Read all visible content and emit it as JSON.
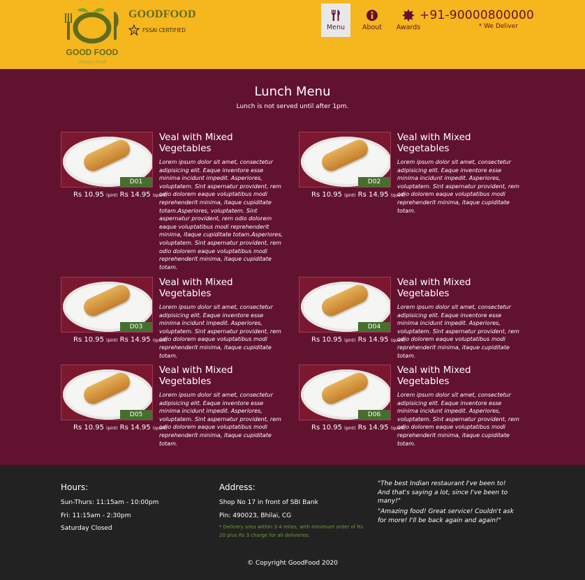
{
  "header": {
    "logo_text": "GOOD FOOD",
    "logo_tagline": "always fresh",
    "brand_name": "GOODFOOD",
    "fssai_label": "FSSAI CERTIFIED",
    "phone": "+91-90000800000",
    "deliver_text": "* We Deliver",
    "nav": [
      {
        "label": "Menu",
        "icon": "fork-knife-icon",
        "active": true
      },
      {
        "label": "About",
        "icon": "info-icon",
        "active": false
      },
      {
        "label": "Awards",
        "icon": "award-icon",
        "active": false
      }
    ],
    "colors": {
      "background": "#f6b61e",
      "accent": "#61122f"
    }
  },
  "menu": {
    "title": "Lunch Menu",
    "subtitle": "Lunch is not served until after 1pm.",
    "items": [
      {
        "code": "D01",
        "name": "Veal with Mixed Vegetables",
        "price_pint": "Rs 10.95",
        "pint_label": "(pint)",
        "price_quart": "Rs 14.95",
        "quart_label": "(quart)",
        "description": "Lorem ipsum dolor sit amet, consectetur adipisicing elit. Eaque inventore esse minima incidunt impedit. Asperiores, voluptatem. Sint aspernatur provident, rem odio dolorem eaque voluptatibus modi reprehenderit minima, itaque cupiditate totam.Asperiores, voluptatem. Sint aspernatur provident, rem odio dolorem eaque voluptatibus modi reprehenderit minima, itaque cupiditate totam.Asperiores, voluptatem. Sint aspernatur provident, rem odio dolorem eaque voluptatibus modi reprehenderit minima, itaque cupiditate totam."
      },
      {
        "code": "D02",
        "name": "Veal with Mixed Vegetables",
        "price_pint": "Rs 10.95",
        "pint_label": "(pint)",
        "price_quart": "Rs 14.95",
        "quart_label": "(quart)",
        "description": "Lorem ipsum dolor sit amet, consectetur adipisicing elit. Eaque inventore esse minima incidunt impedit. Asperiores, voluptatem. Sint aspernatur provident, rem odio dolorem eaque voluptatibus modi reprehenderit minima, itaque cupiditate totam."
      },
      {
        "code": "D03",
        "name": "Veal with Mixed Vegetables",
        "price_pint": "Rs 10.95",
        "pint_label": "(pint)",
        "price_quart": "Rs 14.95",
        "quart_label": "(quart)",
        "description": "Lorem ipsum dolor sit amet, consectetur adipisicing elit. Eaque inventore esse minima incidunt impedit. Asperiores, voluptatem. Sint aspernatur provident, rem odio dolorem eaque voluptatibus modi reprehenderit minima, itaque cupiditate totam."
      },
      {
        "code": "D04",
        "name": "Veal with Mixed Vegetables",
        "price_pint": "Rs 10.95",
        "pint_label": "(pint)",
        "price_quart": "Rs 14.95",
        "quart_label": "(quart)",
        "description": "Lorem ipsum dolor sit amet, consectetur adipisicing elit. Eaque inventore esse minima incidunt impedit. Asperiores, voluptatem. Sint aspernatur provident, rem odio dolorem eaque voluptatibus modi reprehenderit minima, itaque cupiditate totam."
      },
      {
        "code": "D05",
        "name": "Veal with Mixed Vegetables",
        "price_pint": "Rs 10.95",
        "pint_label": "(pint)",
        "price_quart": "Rs 14.95",
        "quart_label": "(quart)",
        "description": "Lorem ipsum dolor sit amet, consectetur adipisicing elit. Eaque inventore esse minima incidunt impedit. Asperiores, voluptatem. Sint aspernatur provident, rem odio dolorem eaque voluptatibus modi reprehenderit minima, itaque cupiditate totam."
      },
      {
        "code": "D06",
        "name": "Veal with Mixed Vegetables",
        "price_pint": "Rs 10.95",
        "pint_label": "(pint)",
        "price_quart": "Rs 14.95",
        "quart_label": "(quart)",
        "description": "Lorem ipsum dolor sit amet, consectetur adipisicing elit. Eaque inventore esse minima incidunt impedit. Asperiores, voluptatem. Sint aspernatur provident, rem odio dolorem eaque voluptatibus modi reprehenderit minima, itaque cupiditate totam."
      }
    ]
  },
  "footer": {
    "hours_title": "Hours:",
    "hours": [
      "Sun-Thurs: 11:15am - 10:00pm",
      "Fri: 11:15am - 2:30pm",
      "Saturday Closed"
    ],
    "address_title": "Address:",
    "address": [
      "Shop No 17 in front of SBI Bank",
      "Pin: 490023, Bhilai, CG"
    ],
    "delivery_note": "* Delivery area within 3-4 miles, with minimum order of Rs 20 plus Rs 3 charge for all deliveries.",
    "quotes": [
      "\"The best Indian restaurant I've been to! And that's saying a lot, since I've been to many!\"",
      "\"Amazing food! Great service! Couldn't ask for more! I'll be back again and again!\""
    ],
    "copyright": "© Copyright GoodFood 2020"
  }
}
